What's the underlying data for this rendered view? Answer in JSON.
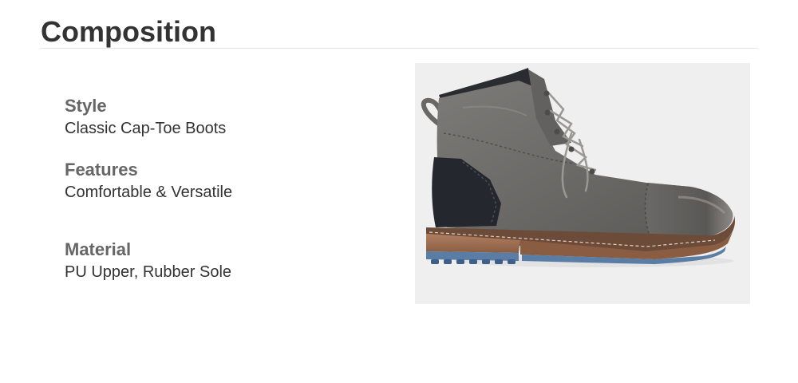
{
  "page": {
    "title": "Composition"
  },
  "specs": [
    {
      "label": "Style",
      "value": "Classic Cap-Toe Boots"
    },
    {
      "label": "Features",
      "value": "Comfortable & Versatile"
    },
    {
      "label": "Material",
      "value": "PU Upper, Rubber Sole"
    }
  ],
  "product_image": {
    "subject": "grey-leather-cap-toe-ankle-boot",
    "colors": {
      "upper": "#6f6d6a",
      "heel_panel": "#24272d",
      "sole": "#a07054",
      "outsole": "#5a7da6",
      "background": "#efefef"
    }
  }
}
